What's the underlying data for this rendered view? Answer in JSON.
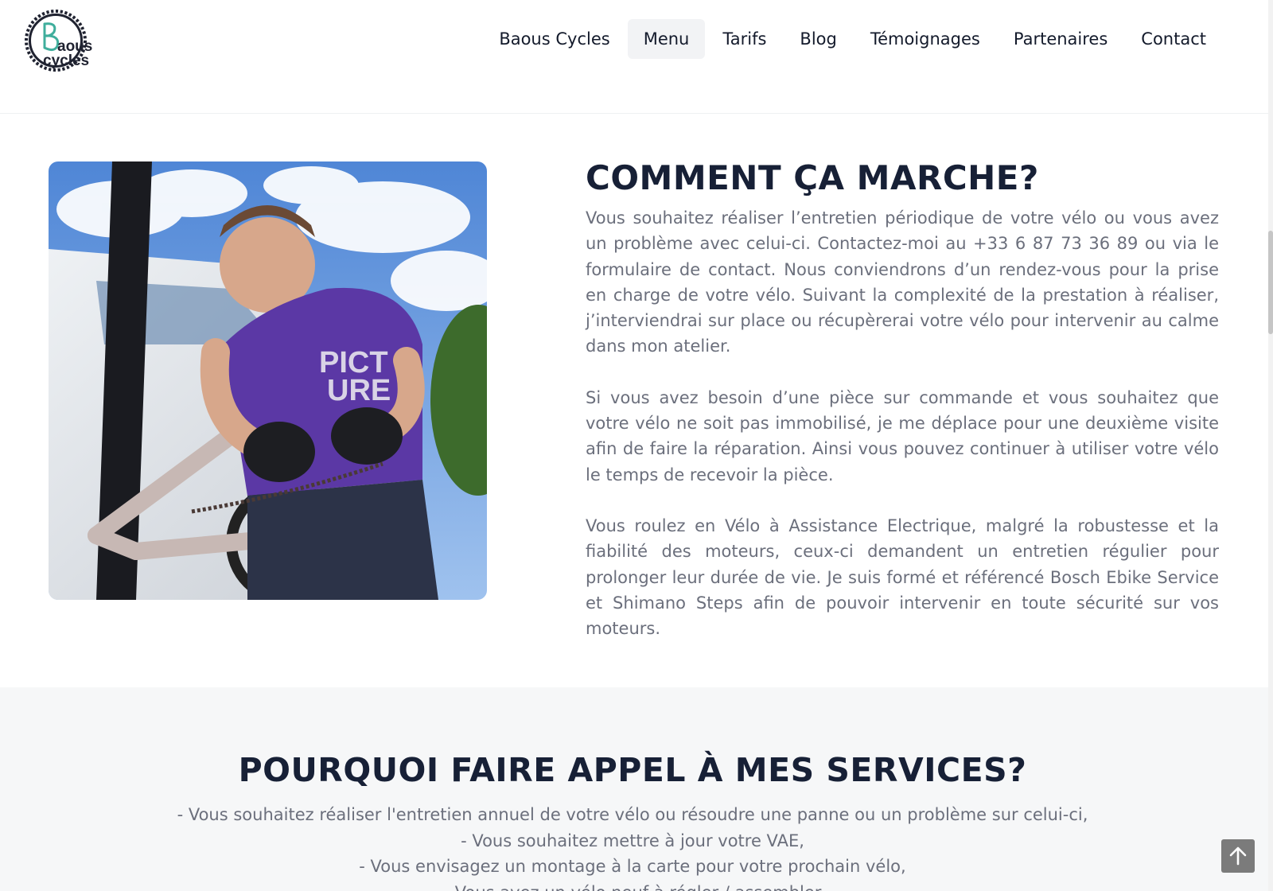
{
  "site": {
    "logo_text": [
      "aous",
      "cycles"
    ]
  },
  "nav": {
    "items": [
      {
        "label": "Baous Cycles"
      },
      {
        "label": "Menu"
      },
      {
        "label": "Tarifs"
      },
      {
        "label": "Blog"
      },
      {
        "label": "Témoignages"
      },
      {
        "label": "Partenaires"
      },
      {
        "label": "Contact"
      }
    ],
    "active": "Menu"
  },
  "how": {
    "title": "COMMENT ÇA MARCHE?",
    "paragraphs": [
      "Vous souhaitez réaliser l’entretien périodique de votre vélo ou vous avez un problème avec celui-ci. Contactez-moi au +33 6 87 73 36 89 ou via le formulaire de contact. Nous conviendrons d’un rendez-vous pour la prise en charge de votre vélo. Suivant la complexité de la prestation à réaliser, j’interviendrai sur place ou récupèrerai votre vélo pour intervenir au calme dans mon atelier.",
      "Si vous avez besoin d’une pièce sur commande et vous souhaitez que votre vélo ne soit pas immobilisé, je me déplace pour une deuxième visite afin de faire la réparation. Ainsi vous pouvez continuer à utiliser votre vélo le temps de recevoir la pièce.",
      "Vous roulez en Vélo à Assistance Electrique, malgré la robustesse et la fiabilité des moteurs, ceux-ci demandent un entretien régulier pour prolonger leur durée de vie. Je suis formé et référencé Bosch Ebike Service et Shimano Steps afin de pouvoir intervenir en toute sécurité sur vos moteurs."
    ],
    "photo_shirt_text": [
      "PICT",
      "URE"
    ]
  },
  "why": {
    "title": "POURQUOI FAIRE APPEL À MES SERVICES?",
    "items": [
      "- Vous souhaitez réaliser l'entretien annuel de votre vélo ou résoudre une panne ou un problème sur celui-ci,",
      "- Vous souhaitez mettre à jour votre VAE,",
      "- Vous envisagez un montage à la carte pour votre prochain vélo,",
      "- Vous avez un vélo neuf à régler / assembler"
    ]
  },
  "colors": {
    "heading": "#172036",
    "body_text": "#6b6f7c",
    "logo_teal": "#3fae9c",
    "nav_active_bg": "#f2f3f5",
    "section_bg": "#f6f7f8"
  },
  "icons": {
    "back_to_top": "arrow-up-icon"
  }
}
